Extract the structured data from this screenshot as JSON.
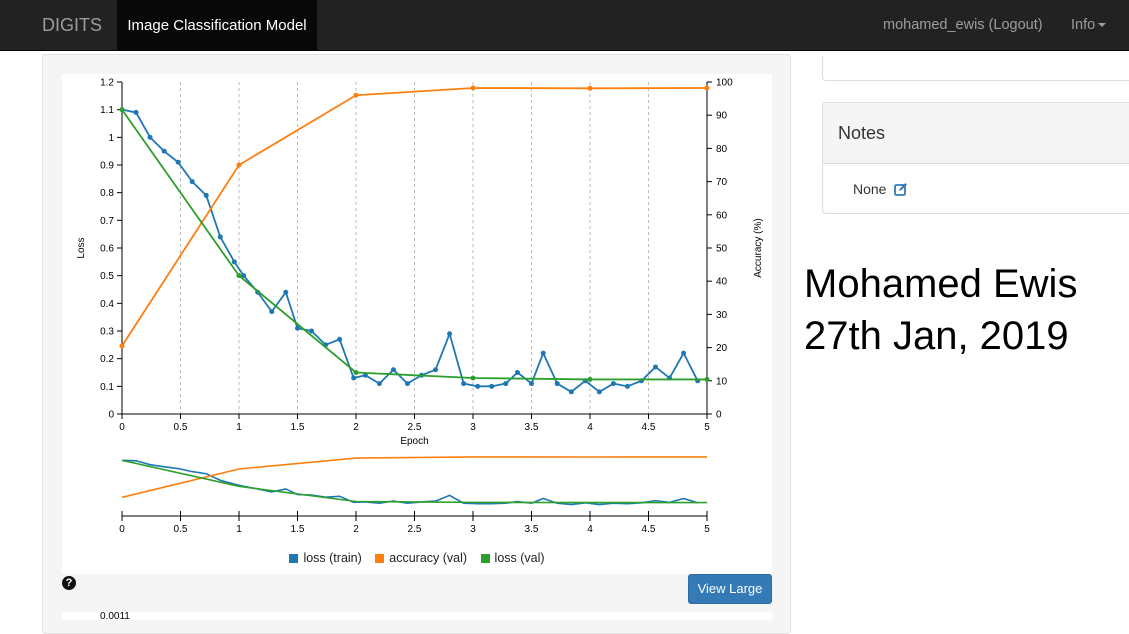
{
  "navbar": {
    "brand": "DIGITS",
    "active_tab": "Image Classification Model",
    "user": "mohamed_ewis (Logout)",
    "info": "Info"
  },
  "notes_panel": {
    "heading": "Notes",
    "value": "None"
  },
  "overlay_text": {
    "line1": "Mohamed Ewis",
    "line2": "27th Jan, 2019"
  },
  "buttons": {
    "view_large": "View Large",
    "help": "?"
  },
  "second_chart": {
    "top_tick": "0.0011"
  },
  "colors": {
    "loss_train": "#1f77b4",
    "accuracy_val": "#ff7f0e",
    "loss_val": "#2ca02c",
    "primary_button": "#337ab7"
  },
  "chart_data": {
    "type": "line",
    "xlabel": "Epoch",
    "ylabel": "Loss",
    "y2label": "Accuracy (%)",
    "xlim": [
      0,
      5
    ],
    "ylim": [
      0,
      1.2
    ],
    "y2lim": [
      0,
      100
    ],
    "x_ticks": [
      "0",
      "0.5",
      "1",
      "1.5",
      "2",
      "2.5",
      "3",
      "3.5",
      "4",
      "4.5",
      "5"
    ],
    "y_ticks": [
      "0",
      "0.1",
      "0.2",
      "0.3",
      "0.4",
      "0.5",
      "0.6",
      "0.7",
      "0.8",
      "0.9",
      "1",
      "1.1",
      "1.2"
    ],
    "y2_ticks": [
      "0",
      "10",
      "20",
      "30",
      "40",
      "50",
      "60",
      "70",
      "80",
      "90",
      "100"
    ],
    "vertical_grid": "dashed at x ticks",
    "legend_position": "bottom",
    "series": [
      {
        "name": "loss (train)",
        "axis": "left",
        "x": [
          0,
          0.12,
          0.24,
          0.36,
          0.48,
          0.6,
          0.72,
          0.84,
          0.96,
          1.04,
          1.16,
          1.28,
          1.4,
          1.5,
          1.62,
          1.74,
          1.86,
          1.98,
          2.08,
          2.2,
          2.32,
          2.44,
          2.56,
          2.68,
          2.8,
          2.92,
          3.04,
          3.16,
          3.28,
          3.38,
          3.5,
          3.6,
          3.72,
          3.84,
          3.96,
          4.08,
          4.2,
          4.32,
          4.44,
          4.56,
          4.68,
          4.8,
          4.92
        ],
        "y": [
          1.1,
          1.09,
          1.0,
          0.95,
          0.91,
          0.84,
          0.79,
          0.64,
          0.55,
          0.5,
          0.44,
          0.37,
          0.44,
          0.31,
          0.3,
          0.25,
          0.27,
          0.13,
          0.14,
          0.11,
          0.16,
          0.11,
          0.14,
          0.16,
          0.29,
          0.11,
          0.1,
          0.1,
          0.11,
          0.15,
          0.11,
          0.22,
          0.11,
          0.08,
          0.12,
          0.08,
          0.11,
          0.1,
          0.12,
          0.17,
          0.13,
          0.22,
          0.12
        ]
      },
      {
        "name": "accuracy (val)",
        "axis": "right",
        "x": [
          0,
          1,
          2,
          3,
          4,
          5
        ],
        "y": [
          20.5,
          75,
          96,
          98.2,
          98.1,
          98.2
        ]
      },
      {
        "name": "loss (val)",
        "axis": "left",
        "x": [
          0,
          1,
          2,
          3,
          4,
          5
        ],
        "y": [
          1.1,
          0.5,
          0.15,
          0.13,
          0.125,
          0.125
        ]
      }
    ]
  }
}
